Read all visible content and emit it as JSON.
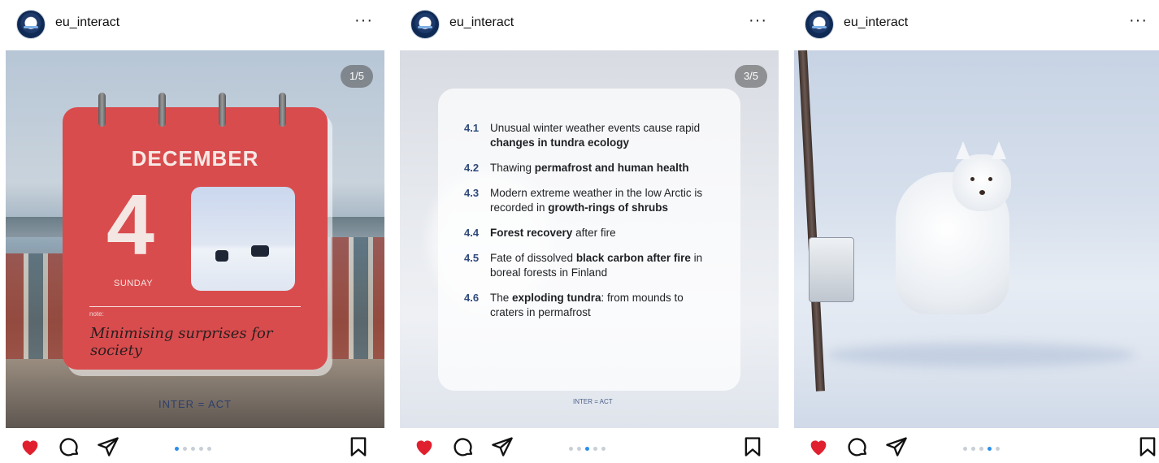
{
  "posts": [
    {
      "username": "eu_interact",
      "more_label": "···",
      "slide_counter": "1/5",
      "active_slide": 1,
      "total_slides": 5,
      "liked": true,
      "calendar": {
        "month": "DECEMBER",
        "day": "4",
        "weekday": "SUNDAY",
        "note_label": "note:",
        "note": "Minimising surprises for society"
      },
      "brand": "INTER = ACT"
    },
    {
      "username": "eu_interact",
      "more_label": "···",
      "slide_counter": "3/5",
      "active_slide": 3,
      "total_slides": 5,
      "liked": true,
      "topics": [
        {
          "num": "4.1",
          "pre": "Unusual winter weather events cause rapid ",
          "bold": "changes in tundra ecology",
          "post": ""
        },
        {
          "num": "4.2",
          "pre": "Thawing ",
          "bold": "permafrost and human health",
          "post": ""
        },
        {
          "num": "4.3",
          "pre": "Modern extreme weather in the low Arctic is recorded in ",
          "bold": "growth-rings of shrubs",
          "post": ""
        },
        {
          "num": "4.4",
          "pre": "",
          "bold": "Forest recovery",
          "post": " after fire"
        },
        {
          "num": "4.5",
          "pre": "Fate of dissolved ",
          "bold": "black carbon after fire",
          "post": " in boreal forests in Finland"
        },
        {
          "num": "4.6",
          "pre": "The ",
          "bold": "exploding tundra",
          "post": ": from mounds to craters in permafrost"
        }
      ],
      "brand": "INTER = ACT"
    },
    {
      "username": "eu_interact",
      "more_label": "···",
      "active_slide": 4,
      "total_slides": 5,
      "liked": true
    }
  ],
  "colors": {
    "like": "#e0202e",
    "dot_active": "#2b8ee8",
    "calendar": "#d94c4e"
  },
  "icons": {
    "like": "heart-icon",
    "comment": "comment-icon",
    "share": "paper-plane-icon",
    "save": "bookmark-icon"
  }
}
